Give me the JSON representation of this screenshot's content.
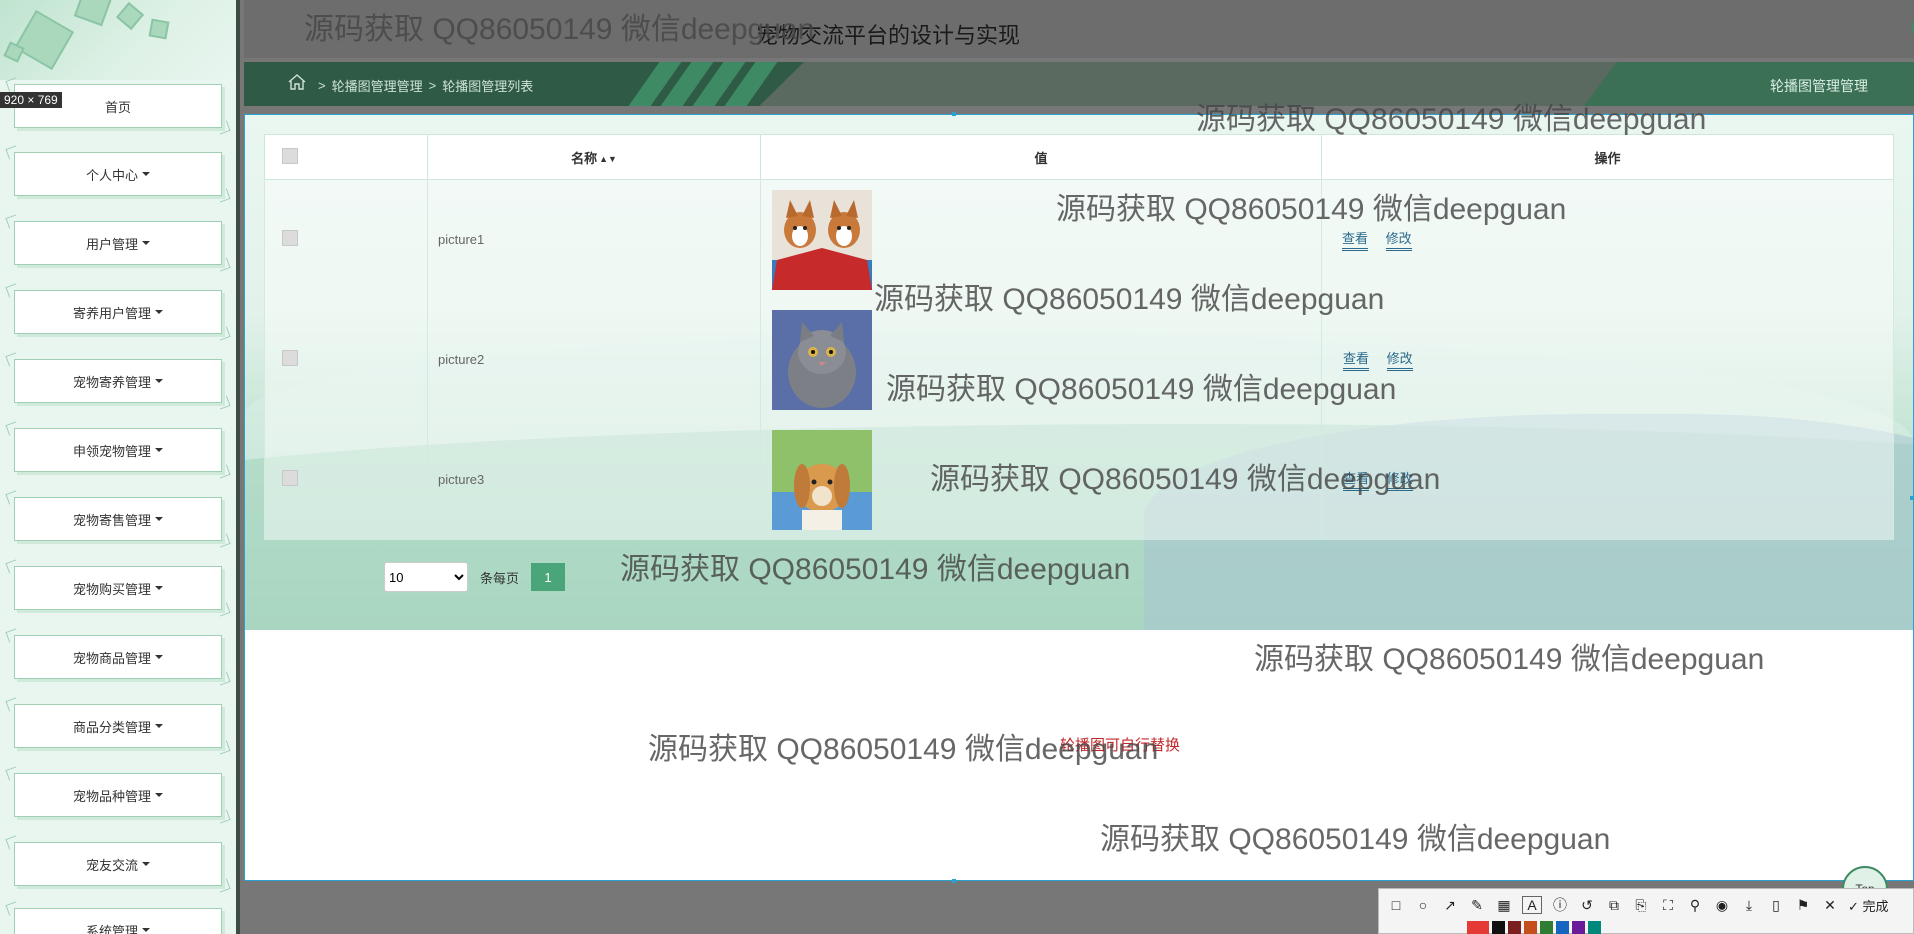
{
  "app": {
    "title": "宠物交流平台的设计与实现",
    "dimension_badge": "920 × 769",
    "fullscreen_icon": "expand-icon",
    "user_icon": "user-icon"
  },
  "breadcrumb": {
    "home_icon": "home-icon",
    "sep": ">",
    "level1": "轮播图管理管理",
    "level2": "轮播图管理列表",
    "right_title": "轮播图管理管理"
  },
  "sidebar": {
    "items": [
      {
        "label": "首页"
      },
      {
        "label": "个人中心"
      },
      {
        "label": "用户管理"
      },
      {
        "label": "寄养用户管理"
      },
      {
        "label": "宠物寄养管理"
      },
      {
        "label": "申领宠物管理"
      },
      {
        "label": "宠物寄售管理"
      },
      {
        "label": "宠物购买管理"
      },
      {
        "label": "宠物商品管理"
      },
      {
        "label": "商品分类管理"
      },
      {
        "label": "宠物品种管理"
      },
      {
        "label": "宠友交流"
      },
      {
        "label": "系统管理"
      }
    ]
  },
  "table": {
    "headers": [
      "",
      "名称",
      "值",
      "操作"
    ],
    "sort_icon": "sort-icon",
    "rows": [
      {
        "name": "picture1",
        "image": "corgi-dogs-image",
        "view": "查看",
        "edit": "修改"
      },
      {
        "name": "picture2",
        "image": "gray-cat-image",
        "view": "查看",
        "edit": "修改"
      },
      {
        "name": "picture3",
        "image": "rabbit-image",
        "view": "查看",
        "edit": "修改"
      }
    ]
  },
  "pager": {
    "page_size": "10",
    "per_page_label": "条每页",
    "current_page": "1"
  },
  "footer_red_text": "轮播图可自行替换",
  "top_button": "Top",
  "toolbar": {
    "done_label": "完成"
  },
  "watermark": "源码获取 QQ86050149 微信deepguan",
  "colors": {
    "primary_green": "#4ba57a",
    "dark_green": "#2f5a45",
    "sidebar_bg": "#e8f6ef",
    "link": "#2b6a8c",
    "red_text": "#c5282c"
  }
}
